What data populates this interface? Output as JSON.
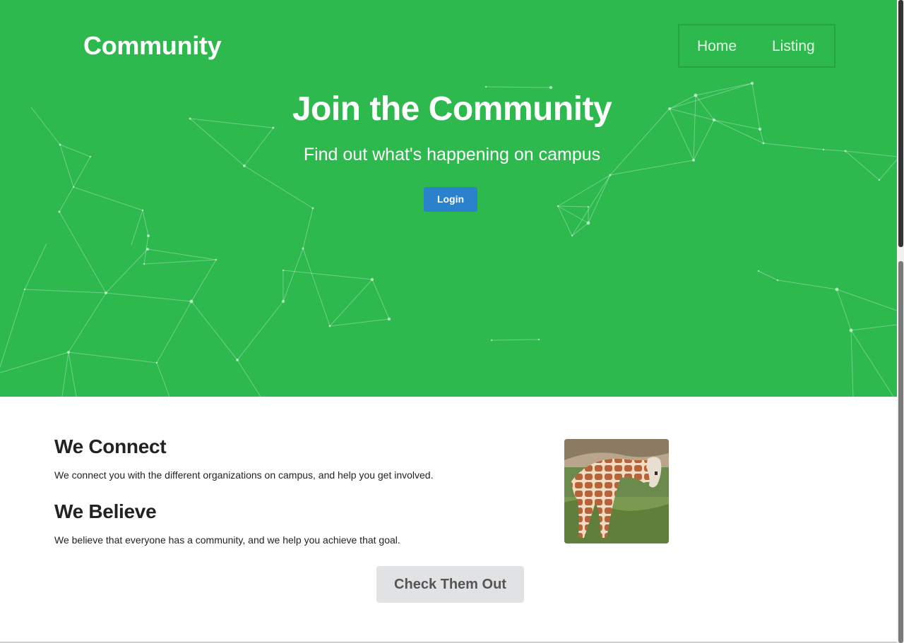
{
  "header": {
    "brand": "Community",
    "nav": [
      {
        "label": "Home"
      },
      {
        "label": "Listing"
      }
    ]
  },
  "hero": {
    "title": "Join the Community",
    "subtitle": "Find out what's happening on campus",
    "login_label": "Login"
  },
  "about": {
    "sections": [
      {
        "heading": "We Connect",
        "text": "We connect you with the different organizations on campus, and help you get involved."
      },
      {
        "heading": "We Believe",
        "text": "We believe that everyone has a community, and we help you achieve that goal."
      }
    ],
    "image_icon": "giraffe-photo"
  },
  "cta": {
    "label": "Check Them Out"
  },
  "colors": {
    "hero_bg": "#2eb94e",
    "login_bg": "#2b82cc",
    "cta_bg": "#e1e2e4"
  }
}
